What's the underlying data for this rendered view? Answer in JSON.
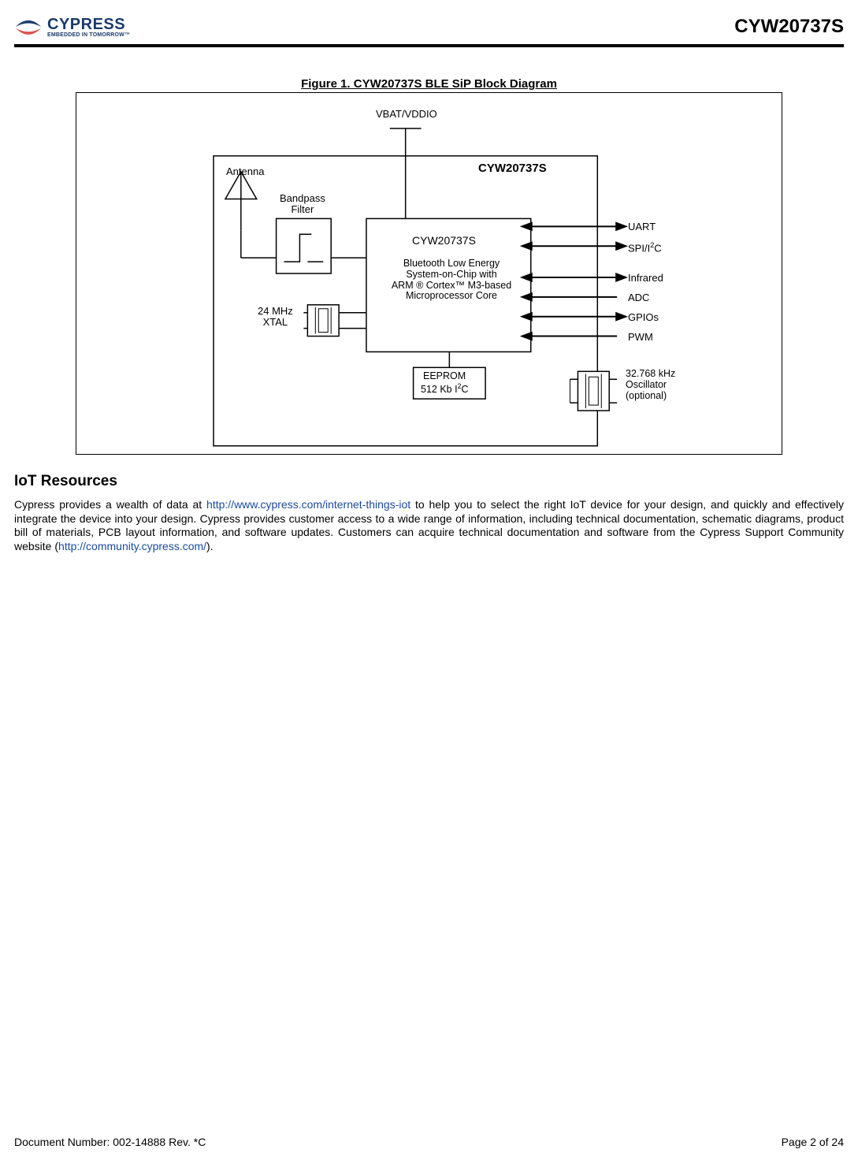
{
  "header": {
    "logo_main": "CYPRESS",
    "logo_sub": "EMBEDDED IN TOMORROW™",
    "part_number": "CYW20737S"
  },
  "figure": {
    "title": "Figure 1. CYW20737S BLE SiP Block Diagram",
    "power_label": "VBAT/VDDIO",
    "chip_label": "CYW20737S",
    "antenna": "Antenna",
    "bandpass": "Bandpass\nFilter",
    "soc_title": "CYW20737S",
    "soc_desc": "Bluetooth Low Energy\nSystem-on-Chip with\nARM ® Cortex™ M3-based\nMicroprocessor Core",
    "xtal": "24 MHz\nXTAL",
    "eeprom_l1": "EEPROM",
    "eeprom_l2": "512 Kb I",
    "eeprom_l3": "C",
    "osc": "32.768 kHz\nOscillator\n(optional)",
    "io": {
      "uart": "UART",
      "spi_pre": "SPI/I",
      "spi_post": "C",
      "infrared": "Infrared",
      "adc": "ADC",
      "gpios": "GPIOs",
      "pwm": "PWM"
    }
  },
  "section": {
    "heading": "IoT Resources",
    "p_before_link1": "Cypress provides a wealth of data at ",
    "link1_text": "http://www.cypress.com/internet-things-iot",
    "p_mid": " to help you to select the right IoT device for your design, and quickly and effectively integrate the device into your design. Cypress provides customer access to a wide range of information, including technical documentation, schematic diagrams, product bill of materials, PCB layout information, and software updates. Customers can acquire technical documentation and software from the Cypress Support Community website (",
    "link2_text": "http://community.cypress.com/",
    "p_after": ")."
  },
  "footer": {
    "doc": "Document Number: 002-14888 Rev. *C",
    "page": "Page 2 of 24"
  }
}
